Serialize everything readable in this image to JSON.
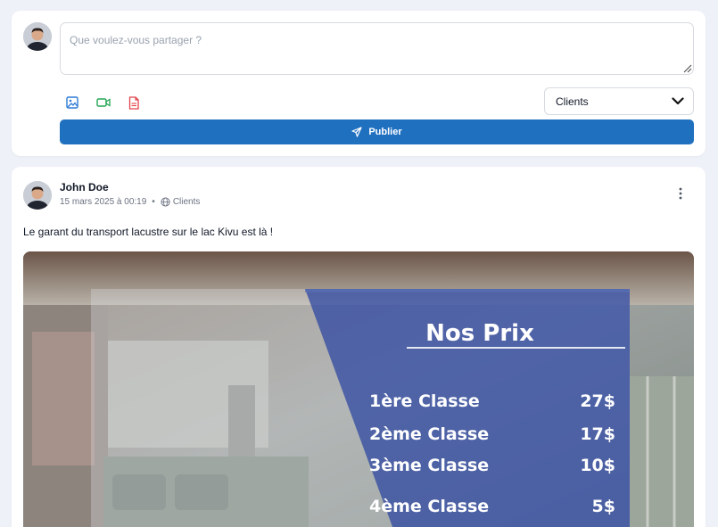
{
  "composer": {
    "placeholder": "Que voulez-vous partager ?",
    "audience": "Clients",
    "publish_label": "Publier",
    "icons": [
      "image-icon",
      "video-icon",
      "file-pdf-icon"
    ]
  },
  "post": {
    "author": "John Doe",
    "timestamp": "15 mars 2025 à 00:19",
    "separator": "•",
    "audience": "Clients",
    "text": "Le garant du transport lacustre sur le lac Kivu est là !",
    "image": {
      "title": "Nos Prix",
      "prices": [
        {
          "label": "1ère Classe",
          "value": "27$"
        },
        {
          "label": "2ème Classe",
          "value": "17$"
        },
        {
          "label": "3ème Classe",
          "value": "10$"
        },
        {
          "label": "4ème Classe",
          "value": "5$"
        }
      ]
    }
  },
  "colors": {
    "background": "#eef1f8",
    "primary": "#2070c0",
    "image_icon": "#2e7bd6",
    "video_icon": "#22a653",
    "pdf_icon": "#e0434a"
  }
}
